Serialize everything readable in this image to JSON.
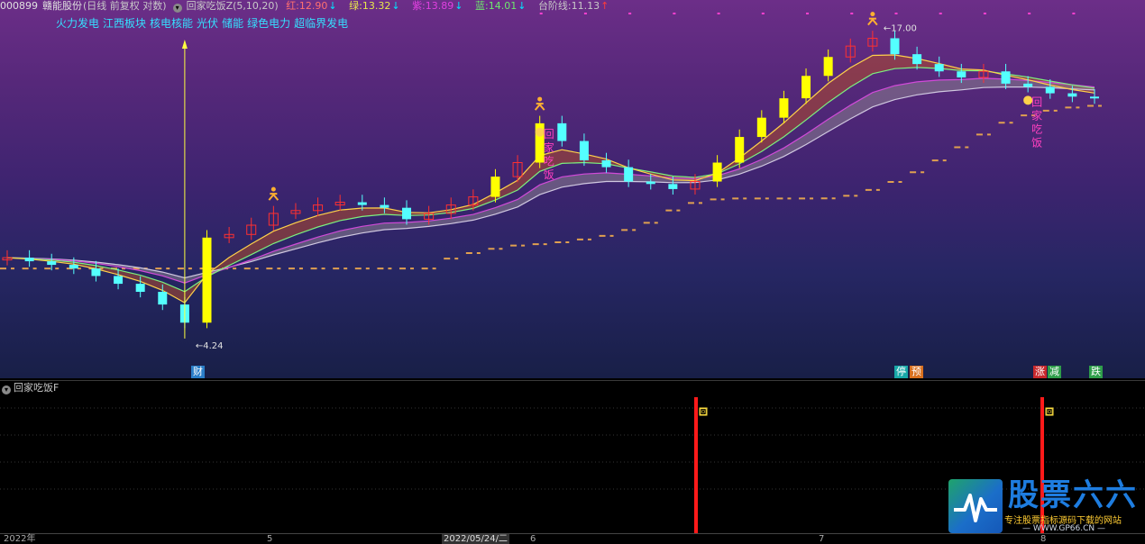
{
  "header": {
    "stock_code": "000899",
    "stock_name": "赣能股份",
    "chart_mode": "(日线 前复权 对数)",
    "indicator_name": "回家吃饭Z(5,10,20)",
    "red_label": "红:",
    "red_value": "12.90",
    "green_label": "绿:",
    "green_value": "13.32",
    "purple_label": "紫:",
    "purple_value": "13.89",
    "blue_label": "蓝:",
    "blue_value": "14.01",
    "step_label": "台阶线:",
    "step_value": "11.13",
    "down_arrow": "↓",
    "up_arrow": "↑"
  },
  "sectors": [
    "火力发电",
    "江西板块",
    "核电核能",
    "光伏",
    "储能",
    "绿色电力",
    "超临界发电"
  ],
  "colors": {
    "up_candle": "#ff3030",
    "down_candle": "#54ffff",
    "limit_candle": "#ffff00",
    "step_line": "#e0a050",
    "signal_text": "#ff40c0",
    "sub_bar": "#ff1a1a"
  },
  "annotations": {
    "low_price": "4.24",
    "high_price": "17.00",
    "signal_chars": [
      "回",
      "家",
      "吃",
      "饭"
    ]
  },
  "bottom_tags": [
    {
      "text": "财",
      "color": "#2a7ec8"
    },
    {
      "text": "停",
      "color": "#18a8a8"
    },
    {
      "text": "预",
      "color": "#d9701e"
    },
    {
      "text": "涨",
      "color": "#c8282c"
    },
    {
      "text": "减",
      "color": "#2e9e4a"
    },
    {
      "text": "跌",
      "color": "#2e9e4a"
    }
  ],
  "sub_panel": {
    "title": "回家吃饭F",
    "marker": "回"
  },
  "time_axis": {
    "year": "2022年",
    "month_5": "5",
    "cursor_date": "2022/05/24/二",
    "month_6": "6",
    "month_7": "7",
    "month_8": "8"
  },
  "logo": {
    "brand": "股票六六",
    "slogan": "专注股票指标源码下载的网站",
    "site": "— WWW.GP66.CN —"
  },
  "chart_data": {
    "type": "candlestick",
    "x_label_positions": [
      "2022年",
      "5",
      "2022/05/24/二",
      "6",
      "7",
      "8"
    ],
    "low_price": 4.24,
    "high_price": 17.0,
    "close_series": [
      6.2,
      6.1,
      6.0,
      5.9,
      5.7,
      5.5,
      5.3,
      5.0,
      4.6,
      6.8,
      6.9,
      7.2,
      7.6,
      7.7,
      7.9,
      8.0,
      7.9,
      7.8,
      7.4,
      7.6,
      7.9,
      8.2,
      9.0,
      9.6,
      11.5,
      10.6,
      9.7,
      9.4,
      8.8,
      8.7,
      8.5,
      8.8,
      9.6,
      10.8,
      11.8,
      12.9,
      14.3,
      15.6,
      16.4,
      17.0,
      15.8,
      15.1,
      14.6,
      14.2,
      14.6,
      13.8,
      13.6,
      13.2,
      13.0,
      12.9
    ],
    "legend": [
      "红",
      "绿",
      "紫",
      "蓝",
      "台阶线"
    ]
  }
}
